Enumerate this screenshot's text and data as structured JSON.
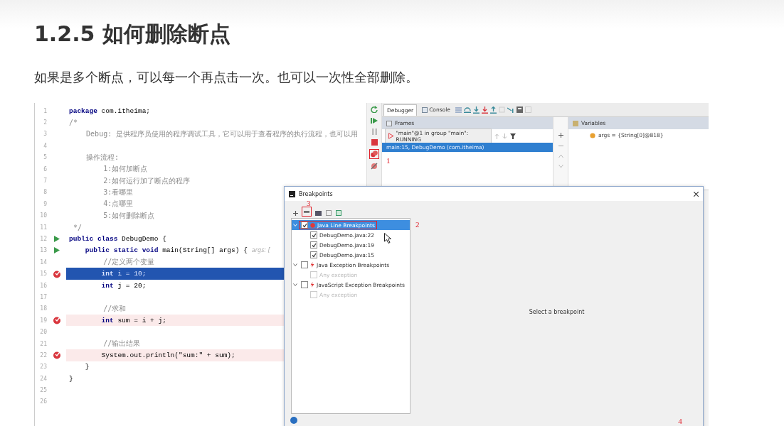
{
  "title": "1.2.5 如何删除断点",
  "intro": "如果是多个断点，可以每一个再点击一次。也可以一次性全部删除。",
  "editor": {
    "lines": [
      {
        "num": "1",
        "kind": "code",
        "text": "**package** com.itheima;",
        "runnable": false,
        "breakpoint": false,
        "current": false
      },
      {
        "num": "2",
        "kind": "comment",
        "text": "/*",
        "runnable": false,
        "breakpoint": false,
        "current": false
      },
      {
        "num": "3",
        "kind": "comment",
        "text": "    Debug: 是供程序员使用的程序调试工具，它可以用于查看程序的执行流程，也可以用",
        "runnable": false,
        "breakpoint": false,
        "current": false
      },
      {
        "num": "4",
        "kind": "blank",
        "runnable": false,
        "breakpoint": false,
        "current": false
      },
      {
        "num": "5",
        "kind": "comment",
        "text": "    操作流程:",
        "runnable": false,
        "breakpoint": false,
        "current": false
      },
      {
        "num": "6",
        "kind": "comment",
        "text": "        1:如何加断点",
        "runnable": false,
        "breakpoint": false,
        "current": false
      },
      {
        "num": "7",
        "kind": "comment",
        "text": "        2:如何运行加了断点的程序",
        "runnable": false,
        "breakpoint": false,
        "current": false
      },
      {
        "num": "8",
        "kind": "comment",
        "text": "        3:看哪里",
        "runnable": false,
        "breakpoint": false,
        "current": false
      },
      {
        "num": "9",
        "kind": "comment",
        "text": "        4:点哪里",
        "runnable": false,
        "breakpoint": false,
        "current": false
      },
      {
        "num": "10",
        "kind": "comment",
        "text": "        5:如何删除断点",
        "runnable": false,
        "breakpoint": false,
        "current": false
      },
      {
        "num": "11",
        "kind": "comment",
        "text": " */",
        "runnable": false,
        "breakpoint": false,
        "current": false
      },
      {
        "num": "12",
        "kind": "code",
        "text": "**public class** DebugDemo {",
        "runnable": true,
        "breakpoint": false,
        "current": false
      },
      {
        "num": "13",
        "kind": "code",
        "text": "    **public static void** main(String[] args) {",
        "hint": "args: [",
        "runnable": true,
        "breakpoint": false,
        "current": false
      },
      {
        "num": "14",
        "kind": "comment",
        "text": "        //定义两个变量",
        "runnable": false,
        "breakpoint": false,
        "current": false
      },
      {
        "num": "15",
        "kind": "code",
        "text": "        **int** i = 10;",
        "runnable": false,
        "breakpoint": true,
        "current": true
      },
      {
        "num": "16",
        "kind": "code",
        "text": "        **int** j = 20;",
        "runnable": false,
        "breakpoint": false,
        "current": false
      },
      {
        "num": "17",
        "kind": "blank",
        "runnable": false,
        "breakpoint": false,
        "current": false
      },
      {
        "num": "18",
        "kind": "comment",
        "text": "        //求和",
        "runnable": false,
        "breakpoint": false,
        "current": false
      },
      {
        "num": "19",
        "kind": "code",
        "text": "        **int** sum = i + j;",
        "runnable": false,
        "breakpoint": true,
        "current": false
      },
      {
        "num": "20",
        "kind": "blank",
        "runnable": false,
        "breakpoint": false,
        "current": false
      },
      {
        "num": "21",
        "kind": "comment",
        "text": "        //输出结果",
        "runnable": false,
        "breakpoint": false,
        "current": false
      },
      {
        "num": "22",
        "kind": "code",
        "text": "        System.out.println(\"sum:\" + sum);",
        "runnable": false,
        "breakpoint": true,
        "current": false
      },
      {
        "num": "23",
        "kind": "code",
        "text": "    }",
        "runnable": false,
        "breakpoint": false,
        "current": false
      },
      {
        "num": "24",
        "kind": "code",
        "text": "}",
        "runnable": false,
        "breakpoint": false,
        "current": false
      },
      {
        "num": "25",
        "kind": "blank",
        "runnable": false,
        "breakpoint": false,
        "current": false
      },
      {
        "num": "26",
        "kind": "blank",
        "runnable": false,
        "breakpoint": false,
        "current": false
      }
    ]
  },
  "debugger": {
    "tabs": [
      {
        "label": "Debugger",
        "selected": true
      },
      {
        "label": "Console",
        "selected": false
      }
    ],
    "breakpoints_annotation": "1",
    "frames": {
      "title": "Frames",
      "thread": "\"main\"@1 in group \"main\": RUNNING",
      "items": [
        {
          "label": "main:15, DebugDemo (com.itheima)",
          "selected": true
        }
      ]
    },
    "variables": {
      "title": "Variables",
      "items": [
        {
          "text": "args = {String[0]@818}"
        }
      ]
    }
  },
  "breakpoints_dialog": {
    "title": "Breakpoints",
    "remove_annotation": "3",
    "tree": [
      {
        "label": "Java Line Breakpoints",
        "kind": "line",
        "checked": true,
        "expanded": true,
        "selected": true,
        "disabled": false,
        "annotation": "2",
        "children": [
          {
            "label": "DebugDemo.java:22",
            "checked": true,
            "selected": false,
            "disabled": false
          },
          {
            "label": "DebugDemo.java:19",
            "checked": true,
            "selected": false,
            "disabled": false
          },
          {
            "label": "DebugDemo.java:15",
            "checked": true,
            "selected": false,
            "disabled": false
          }
        ]
      },
      {
        "label": "Java Exception Breakpoints",
        "kind": "exception",
        "checked": false,
        "expanded": true,
        "selected": false,
        "disabled": false,
        "children": [
          {
            "label": "Any exception",
            "checked": false,
            "selected": false,
            "disabled": true
          }
        ]
      },
      {
        "label": "JavaScript Exception Breakpoints",
        "kind": "exception",
        "checked": false,
        "expanded": true,
        "selected": false,
        "disabled": false,
        "children": [
          {
            "label": "Any exception",
            "checked": false,
            "selected": false,
            "disabled": true
          }
        ]
      }
    ],
    "empty_message": "Select a breakpoint",
    "button_annotation": "4"
  }
}
